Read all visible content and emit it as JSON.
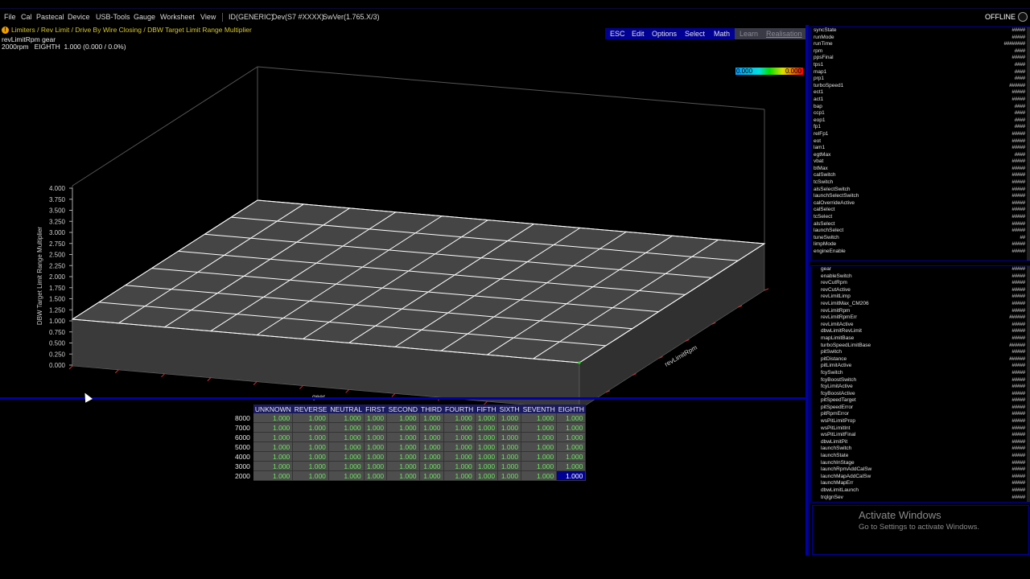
{
  "menu": {
    "items": [
      {
        "id": "file",
        "label": "File"
      },
      {
        "id": "cal",
        "label": "Cal"
      },
      {
        "id": "pastecal",
        "label": "Pastecal"
      },
      {
        "id": "device",
        "label": "Device"
      },
      {
        "id": "usbtools",
        "label": "USB-Tools"
      },
      {
        "id": "gauge",
        "label": "Gauge"
      },
      {
        "id": "worksheet",
        "label": "Worksheet"
      },
      {
        "id": "view",
        "label": "View"
      }
    ],
    "device_id": "ID(GENERIC)",
    "device_dev": "Dev(S7 #XXXX)",
    "sw_ver": "SwVer(1.765.X/3)",
    "status": "OFFLINE"
  },
  "breadcrumb": "Limiters / Rev Limit / Drive By Wire Closing / DBW Target Limit Range Multiplier",
  "axis_info": {
    "row_axis": "revLimitRpm",
    "col_axis": "gear",
    "row_value": "2000rpm",
    "col_value": "EIGHTH",
    "cell_value": "1.000 (0.000 / 0.0%)"
  },
  "toolbar": {
    "esc": "ESC",
    "edit": "Edit",
    "options": "Options",
    "select": "Select",
    "math": "Math",
    "learn": "Learn",
    "realisation": "Realisation"
  },
  "colorbar": {
    "min": "0.000",
    "max": "0.000"
  },
  "plot3d": {
    "zlabel": "DBW Target Limit Range Multiplier",
    "xlabel": "gear",
    "ylabel": "revLimitRpm",
    "z_ticks": [
      "4.000",
      "3.750",
      "3.500",
      "3.250",
      "3.000",
      "2.750",
      "2.500",
      "2.250",
      "2.000",
      "1.750",
      "1.500",
      "1.250",
      "1.000",
      "0.750",
      "0.500",
      "0.250",
      "0.000"
    ]
  },
  "table": {
    "columns": [
      "UNKNOWN",
      "REVERSE",
      "NEUTRAL",
      "FIRST",
      "SECOND",
      "THIRD",
      "FOURTH",
      "FIFTH",
      "SIXTH",
      "SEVENTH",
      "EIGHTH"
    ],
    "rows": [
      {
        "rpm": "8000",
        "values": [
          "1.000",
          "1.000",
          "1.000",
          "1.000",
          "1.000",
          "1.000",
          "1.000",
          "1.000",
          "1.000",
          "1.000",
          "1.000"
        ]
      },
      {
        "rpm": "7000",
        "values": [
          "1.000",
          "1.000",
          "1.000",
          "1.000",
          "1.000",
          "1.000",
          "1.000",
          "1.000",
          "1.000",
          "1.000",
          "1.000"
        ]
      },
      {
        "rpm": "6000",
        "values": [
          "1.000",
          "1.000",
          "1.000",
          "1.000",
          "1.000",
          "1.000",
          "1.000",
          "1.000",
          "1.000",
          "1.000",
          "1.000"
        ]
      },
      {
        "rpm": "5000",
        "values": [
          "1.000",
          "1.000",
          "1.000",
          "1.000",
          "1.000",
          "1.000",
          "1.000",
          "1.000",
          "1.000",
          "1.000",
          "1.000"
        ]
      },
      {
        "rpm": "4000",
        "values": [
          "1.000",
          "1.000",
          "1.000",
          "1.000",
          "1.000",
          "1.000",
          "1.000",
          "1.000",
          "1.000",
          "1.000",
          "1.000"
        ]
      },
      {
        "rpm": "3000",
        "values": [
          "1.000",
          "1.000",
          "1.000",
          "1.000",
          "1.000",
          "1.000",
          "1.000",
          "1.000",
          "1.000",
          "1.000",
          "1.000"
        ]
      },
      {
        "rpm": "2000",
        "values": [
          "1.000",
          "1.000",
          "1.000",
          "1.000",
          "1.000",
          "1.000",
          "1.000",
          "1.000",
          "1.000",
          "1.000",
          "1.000"
        ]
      }
    ],
    "selected": {
      "row": 6,
      "col": 10
    }
  },
  "channels_top": [
    {
      "name": "syncState",
      "value": "#####"
    },
    {
      "name": "runMode",
      "value": "#####"
    },
    {
      "name": "runTime",
      "value": "########"
    },
    {
      "name": "rpm",
      "value": "####"
    },
    {
      "name": "ppsFinal",
      "value": "#####"
    },
    {
      "name": "tps1",
      "value": "####"
    },
    {
      "name": "map1",
      "value": "####"
    },
    {
      "name": "prp1",
      "value": "####"
    },
    {
      "name": "turboSpeed1",
      "value": "######"
    },
    {
      "name": "ect1",
      "value": "#####"
    },
    {
      "name": "act1",
      "value": "#####"
    },
    {
      "name": "bap",
      "value": "####"
    },
    {
      "name": "ccp1",
      "value": "####"
    },
    {
      "name": "eop1",
      "value": "####"
    },
    {
      "name": "fp1",
      "value": "####"
    },
    {
      "name": "relFp1",
      "value": "#####"
    },
    {
      "name": "eot",
      "value": "#####"
    },
    {
      "name": "lam1",
      "value": "#####"
    },
    {
      "name": "egtMax",
      "value": "####"
    },
    {
      "name": "vbat",
      "value": "#####"
    },
    {
      "name": "btMax",
      "value": "#####"
    },
    {
      "name": "calSwitch",
      "value": "#####"
    },
    {
      "name": "tcSwitch",
      "value": "#####"
    },
    {
      "name": "alsSelectSwitch",
      "value": "#####"
    },
    {
      "name": "launchSelectSwitch",
      "value": "#####"
    },
    {
      "name": "calOverrideActive",
      "value": "#####"
    },
    {
      "name": "calSelect",
      "value": "#####"
    },
    {
      "name": "tcSelect",
      "value": "#####"
    },
    {
      "name": "alsSelect",
      "value": "#####"
    },
    {
      "name": "launchSelect",
      "value": "#####"
    },
    {
      "name": "tuneSwitch",
      "value": "##"
    },
    {
      "name": "limpMode",
      "value": "#####"
    },
    {
      "name": "engineEnable",
      "value": "#####"
    }
  ],
  "channels_bottom": [
    {
      "name": "gear",
      "value": "#####"
    },
    {
      "name": "enableSwitch",
      "value": "#####"
    },
    {
      "name": "revCutRpm",
      "value": "#####"
    },
    {
      "name": "revCutActive",
      "value": "#####"
    },
    {
      "name": "revLimitLimp",
      "value": "#####"
    },
    {
      "name": "revLimitMax_CM206",
      "value": "#####"
    },
    {
      "name": "revLimitRpm",
      "value": "#####"
    },
    {
      "name": "revLimitRpmErr",
      "value": "######"
    },
    {
      "name": "revLimitActive",
      "value": "#####"
    },
    {
      "name": "dbwLimitRevLimit",
      "value": "#####"
    },
    {
      "name": "mapLimitBase",
      "value": "#####"
    },
    {
      "name": "turboSpeedLimitBase",
      "value": "######"
    },
    {
      "name": "pitSwitch",
      "value": "#####"
    },
    {
      "name": "pitDistance",
      "value": "######"
    },
    {
      "name": "pitLimitActive",
      "value": "#####"
    },
    {
      "name": "fcySwitch",
      "value": "#####"
    },
    {
      "name": "fcyBoostSwitch",
      "value": "#####"
    },
    {
      "name": "fcyLimitActive",
      "value": "#####"
    },
    {
      "name": "fcyBoostActive",
      "value": "#####"
    },
    {
      "name": "pitSpeedTarget",
      "value": "#####"
    },
    {
      "name": "pitSpeedError",
      "value": "#####"
    },
    {
      "name": "pitRpmError",
      "value": "#####"
    },
    {
      "name": "wsPitLimitProp",
      "value": "#####"
    },
    {
      "name": "wsPitLimitInt",
      "value": "#####"
    },
    {
      "name": "wsPitLimitFinal",
      "value": "#####"
    },
    {
      "name": "dbwLimitPit",
      "value": "#####"
    },
    {
      "name": "launchSwitch",
      "value": "#####"
    },
    {
      "name": "launchState",
      "value": "#####"
    },
    {
      "name": "launchInStage",
      "value": "#####"
    },
    {
      "name": "launchRpmAddCalSw",
      "value": "#####"
    },
    {
      "name": "launchMapAddCalSw",
      "value": "#####"
    },
    {
      "name": "launchMapErr",
      "value": "#####"
    },
    {
      "name": "dbwLimitLaunch",
      "value": "#####"
    },
    {
      "name": "trqIgnSev",
      "value": "#####"
    }
  ],
  "watermark": {
    "title": "Activate Windows",
    "subtitle": "Go to Settings to activate Windows."
  }
}
